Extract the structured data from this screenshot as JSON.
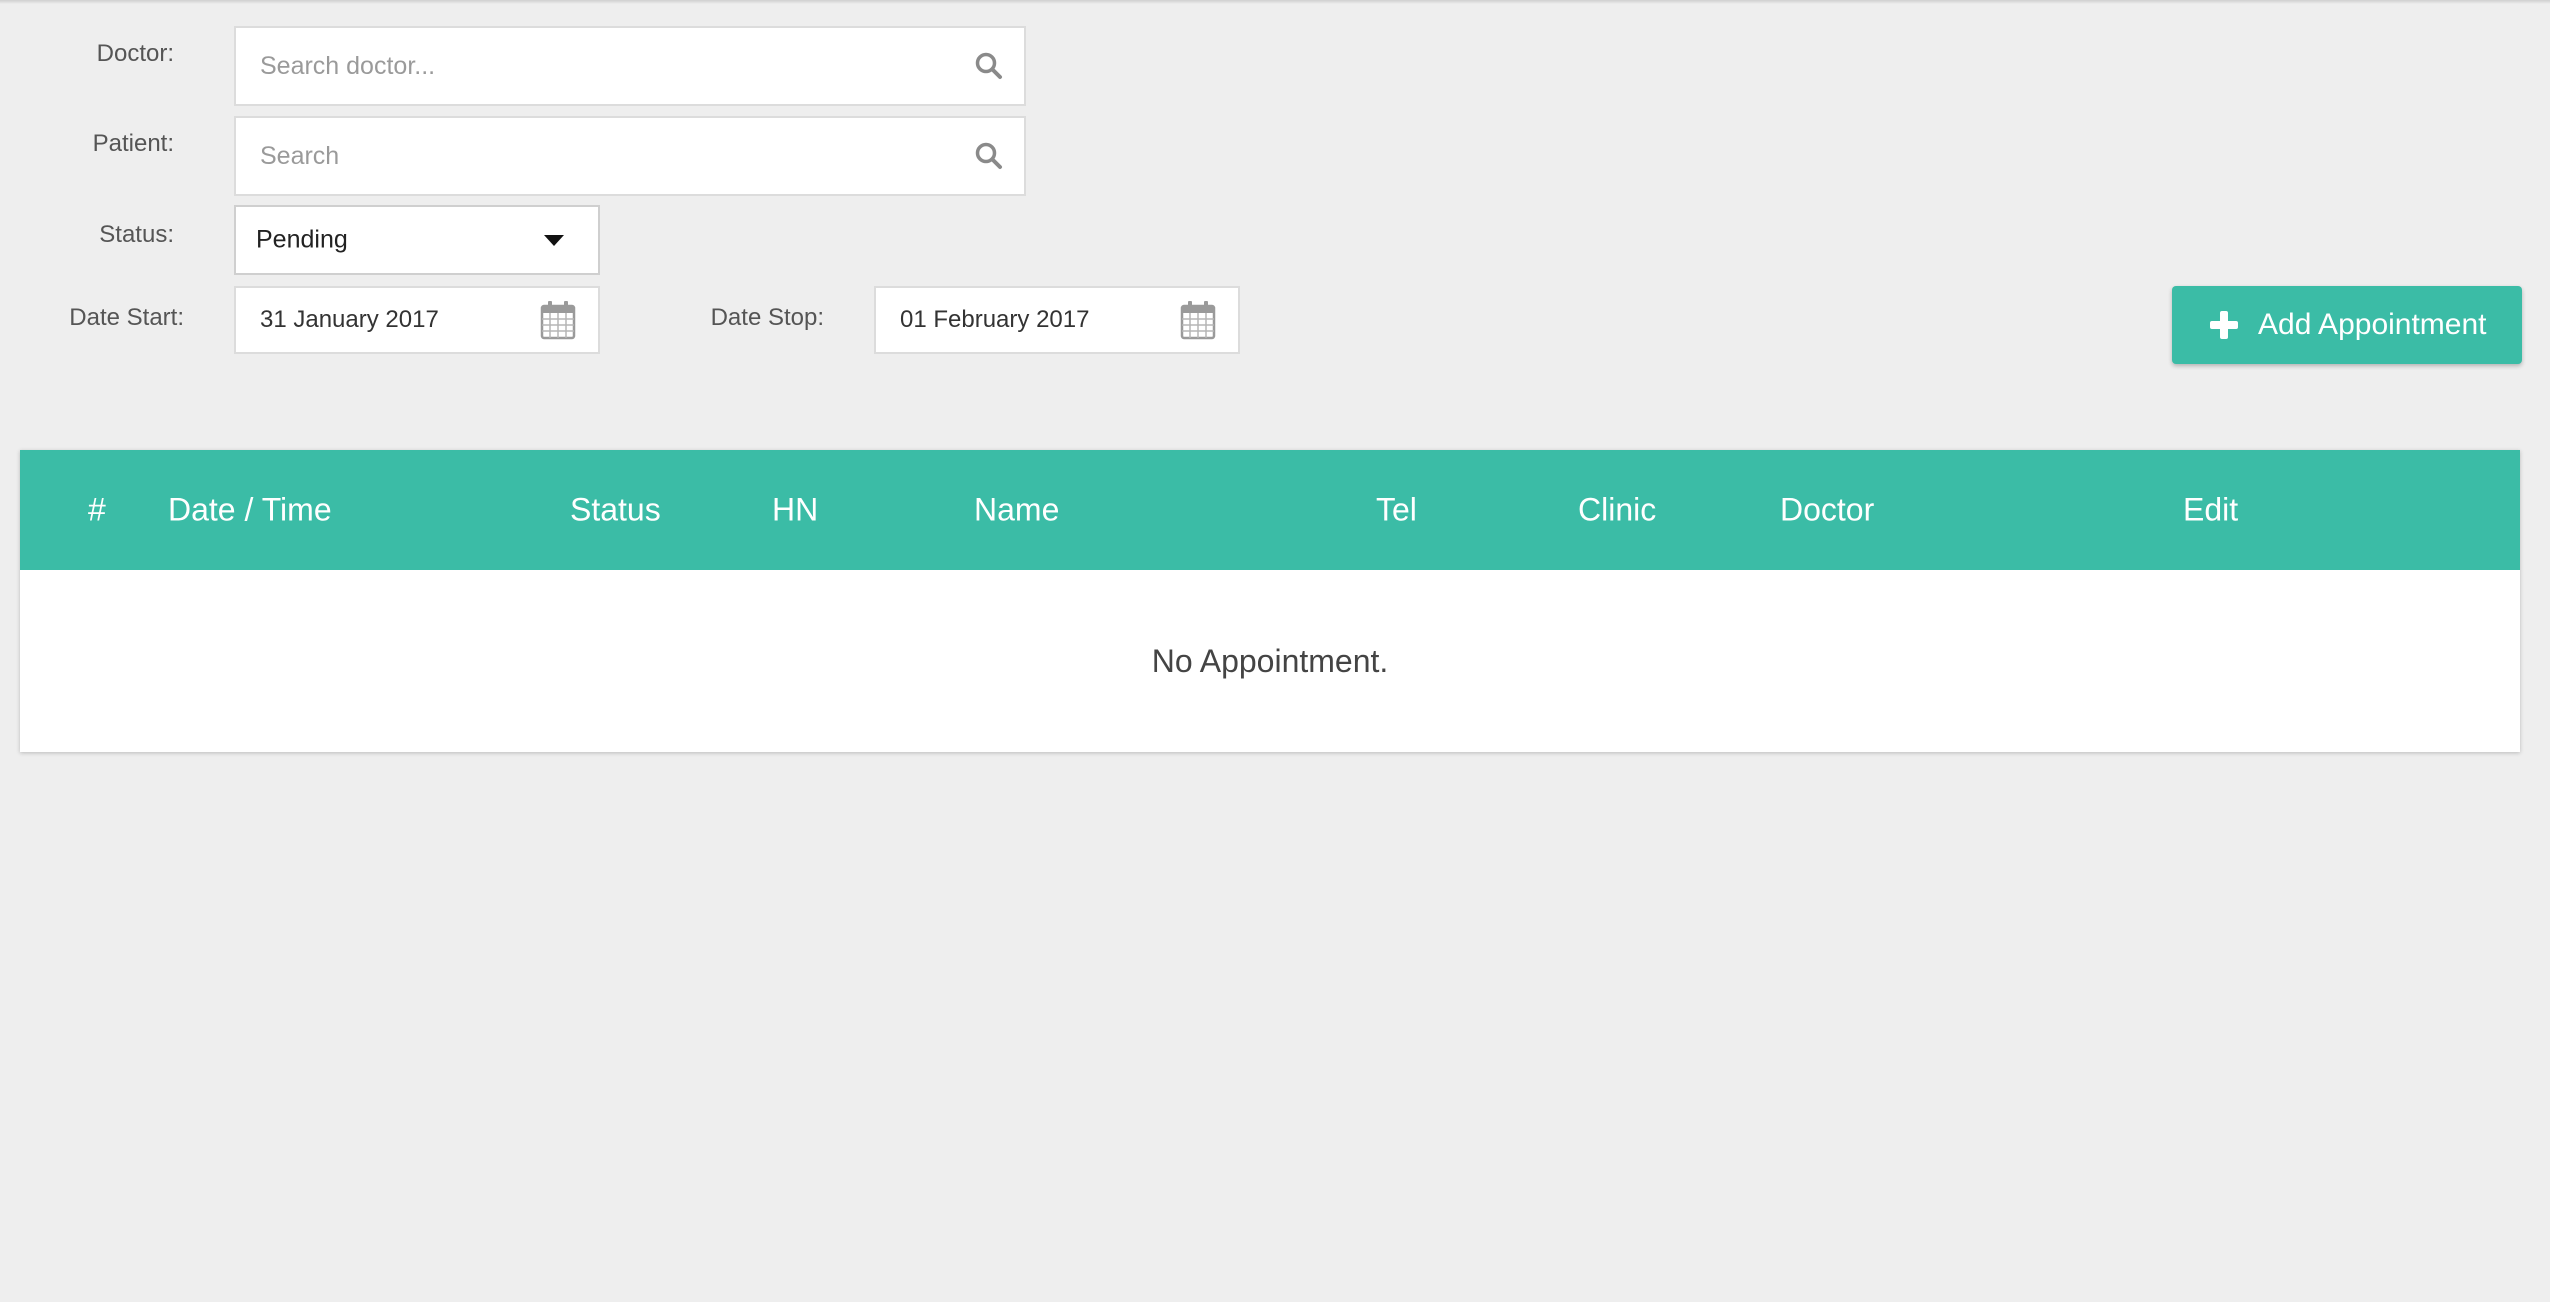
{
  "filters": {
    "doctor": {
      "label": "Doctor:",
      "placeholder": "Search doctor...",
      "value": ""
    },
    "patient": {
      "label": "Patient:",
      "placeholder": "Search",
      "value": ""
    },
    "status": {
      "label": "Status:",
      "selected": "Pending"
    },
    "date_start": {
      "label": "Date Start:",
      "value": "31 January 2017"
    },
    "date_stop": {
      "label": "Date Stop:",
      "value": "01 February 2017"
    }
  },
  "actions": {
    "add_label": "Add Appointment"
  },
  "table": {
    "headers": [
      "#",
      "Date / Time",
      "Status",
      "HN",
      "Name",
      "Tel",
      "Clinic",
      "Doctor",
      "Edit"
    ],
    "empty_message": "No Appointment."
  },
  "colors": {
    "accent": "#3bbca6",
    "background": "#eeeeee"
  },
  "icons": {
    "search": "search-icon",
    "dropdown": "caret-down-icon",
    "calendar": "calendar-icon",
    "add": "plus-icon"
  }
}
